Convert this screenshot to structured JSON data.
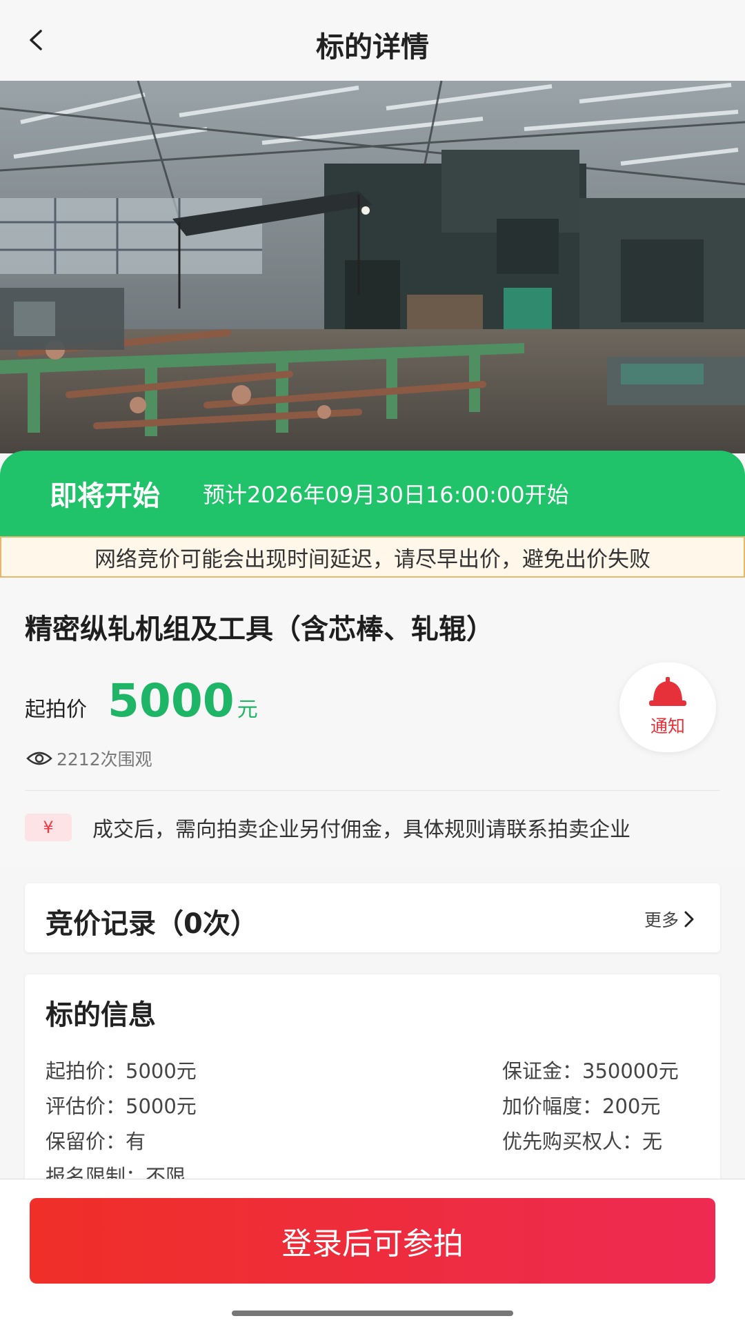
{
  "header": {
    "title": "标的详情",
    "back_icon": "chevron-left-icon"
  },
  "hero": {
    "image_subject": "factory-rolling-mill-photo"
  },
  "status": {
    "label": "即将开始",
    "time_text": "预计2026年09月30日16:00:00开始",
    "color": "#20c26a"
  },
  "notice": {
    "text": "网络竞价可能会出现时间延迟，请尽早出价，避免出价失败"
  },
  "item": {
    "title": "精密纵轧机组及工具（含芯棒、轧辊）",
    "price_label": "起拍价",
    "price_value": "5000",
    "price_unit": "元",
    "views_text": "2212次围观",
    "commission_badge": "¥",
    "commission_text": "成交后，需向拍卖企业另付佣金，具体规则请联系拍卖企业"
  },
  "notify": {
    "label": "通知",
    "icon": "bell-icon"
  },
  "bid_record": {
    "title": "竞价记录（0次）",
    "more_label": "更多"
  },
  "info": {
    "title": "标的信息",
    "rows": [
      {
        "left": "起拍价：5000元",
        "right": "保证金：350000元"
      },
      {
        "left": "评估价：5000元",
        "right": "加价幅度：200元"
      },
      {
        "left": "保留价：有",
        "right": "优先购买权人：无"
      },
      {
        "left": "报名限制：不限",
        "right": ""
      }
    ]
  },
  "footer": {
    "login_button": "登录后可参拍"
  },
  "colors": {
    "accent_green": "#1fb567",
    "accent_red": "#ef2f28"
  }
}
